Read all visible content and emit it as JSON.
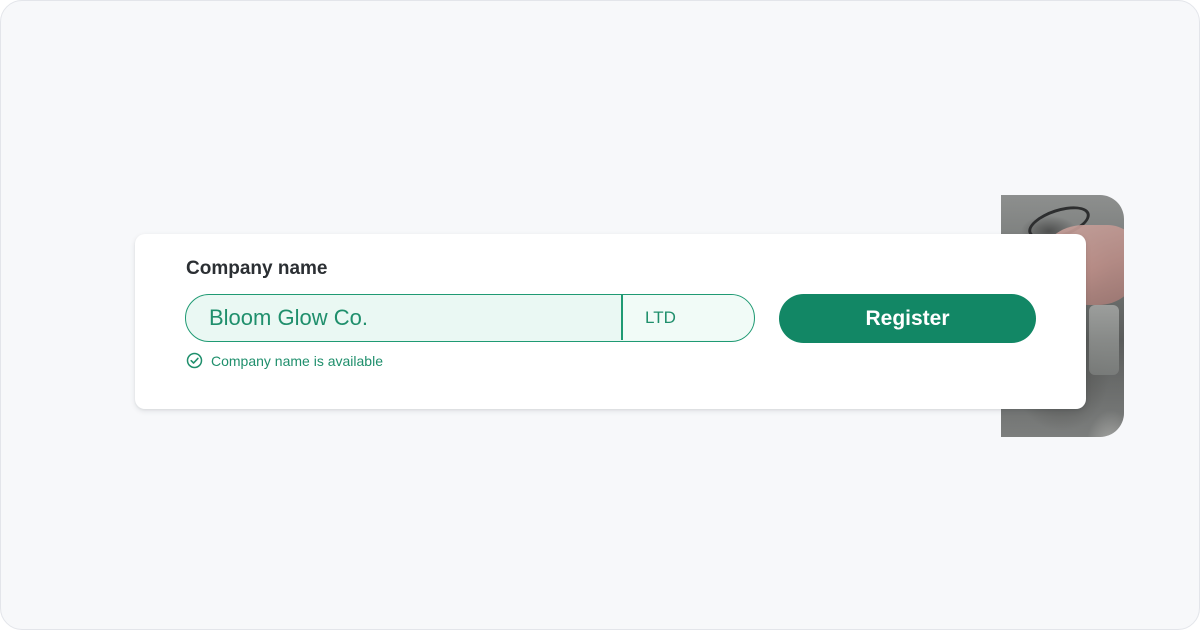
{
  "form": {
    "label": "Company name",
    "company_name_value": "Bloom Glow Co.",
    "suffix": "LTD",
    "register_label": "Register",
    "status_text": "Company name is available",
    "status_icon": "check-circle-icon"
  },
  "colors": {
    "accent": "#128765",
    "field_border": "#1f9a73",
    "field_background": "#eaf8f3",
    "page_background": "#f7f8fa"
  }
}
